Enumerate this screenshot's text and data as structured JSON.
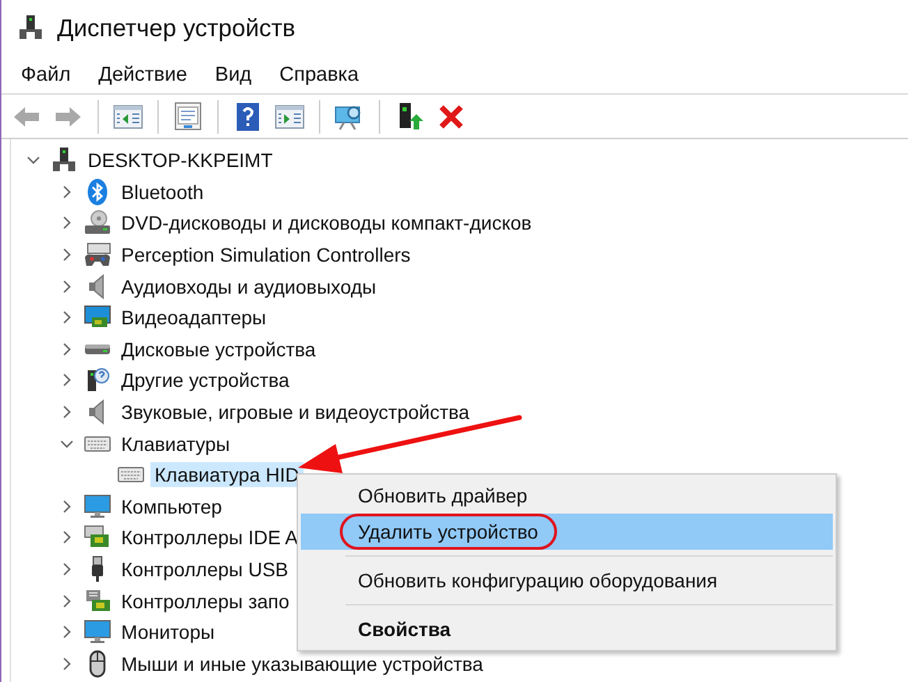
{
  "window": {
    "title": "Диспетчер устройств"
  },
  "menu_bar": [
    "Файл",
    "Действие",
    "Вид",
    "Справка"
  ],
  "toolbar": [
    {
      "kind": "back",
      "disabled": true
    },
    {
      "kind": "forward",
      "disabled": true
    },
    {
      "kind": "separator"
    },
    {
      "kind": "panel-left",
      "disabled": false
    },
    {
      "kind": "separator"
    },
    {
      "kind": "properties",
      "disabled": false
    },
    {
      "kind": "separator"
    },
    {
      "kind": "help",
      "disabled": false
    },
    {
      "kind": "panel-right",
      "disabled": false
    },
    {
      "kind": "separator"
    },
    {
      "kind": "scan",
      "disabled": false
    },
    {
      "kind": "separator"
    },
    {
      "kind": "update-driver",
      "disabled": false
    },
    {
      "kind": "remove",
      "disabled": false
    }
  ],
  "tree": [
    {
      "label": "DESKTOP-KKPEIMT",
      "kind": "computer",
      "expanded": true,
      "selected": false,
      "children": [
        {
          "label": "Bluetooth",
          "kind": "bluetooth",
          "expanded": false,
          "selected": false
        },
        {
          "label": "DVD-дисководы и дисководы компакт-дисков",
          "kind": "disc-drive",
          "expanded": false,
          "selected": false
        },
        {
          "label": "Perception Simulation Controllers",
          "kind": "gamepad",
          "expanded": false,
          "selected": false
        },
        {
          "label": "Аудиовходы и аудиовыходы",
          "kind": "speaker",
          "expanded": false,
          "selected": false
        },
        {
          "label": "Видеоадаптеры",
          "kind": "display-adapter",
          "expanded": false,
          "selected": false
        },
        {
          "label": "Дисковые устройства",
          "kind": "drive",
          "expanded": false,
          "selected": false
        },
        {
          "label": "Другие устройства",
          "kind": "unknown-device",
          "expanded": false,
          "selected": false
        },
        {
          "label": "Звуковые, игровые и видеоустройства",
          "kind": "speaker",
          "expanded": false,
          "selected": false
        },
        {
          "label": "Клавиатуры",
          "kind": "keyboard",
          "expanded": true,
          "selected": false,
          "children": [
            {
              "label": "Клавиатура HID",
              "kind": "keyboard",
              "selected": true
            }
          ]
        },
        {
          "label": "Компьютер",
          "kind": "monitor",
          "expanded": false,
          "selected": false
        },
        {
          "label": "Контроллеры IDE A",
          "kind": "ide-card",
          "expanded": false,
          "selected": false
        },
        {
          "label": "Контроллеры USB",
          "kind": "usb",
          "expanded": false,
          "selected": false
        },
        {
          "label": "Контроллеры запо",
          "kind": "storage-card",
          "expanded": false,
          "selected": false
        },
        {
          "label": "Мониторы",
          "kind": "monitor",
          "expanded": false,
          "selected": false
        },
        {
          "label": "Мыши и иные указывающие устройства",
          "kind": "mouse",
          "expanded": false,
          "selected": false
        }
      ]
    }
  ],
  "context_menu": {
    "items": [
      {
        "kind": "item",
        "label": "Обновить драйвер",
        "selected": false,
        "bold": false,
        "circled": false
      },
      {
        "kind": "item",
        "label": "Удалить устройство",
        "selected": true,
        "bold": false,
        "circled": true
      },
      {
        "kind": "separator"
      },
      {
        "kind": "item",
        "label": "Обновить конфигурацию оборудования",
        "selected": false,
        "bold": false,
        "circled": false
      },
      {
        "kind": "separator"
      },
      {
        "kind": "item",
        "label": "Свойства",
        "selected": false,
        "bold": true,
        "circled": false
      }
    ]
  },
  "annotation_arrow": true
}
